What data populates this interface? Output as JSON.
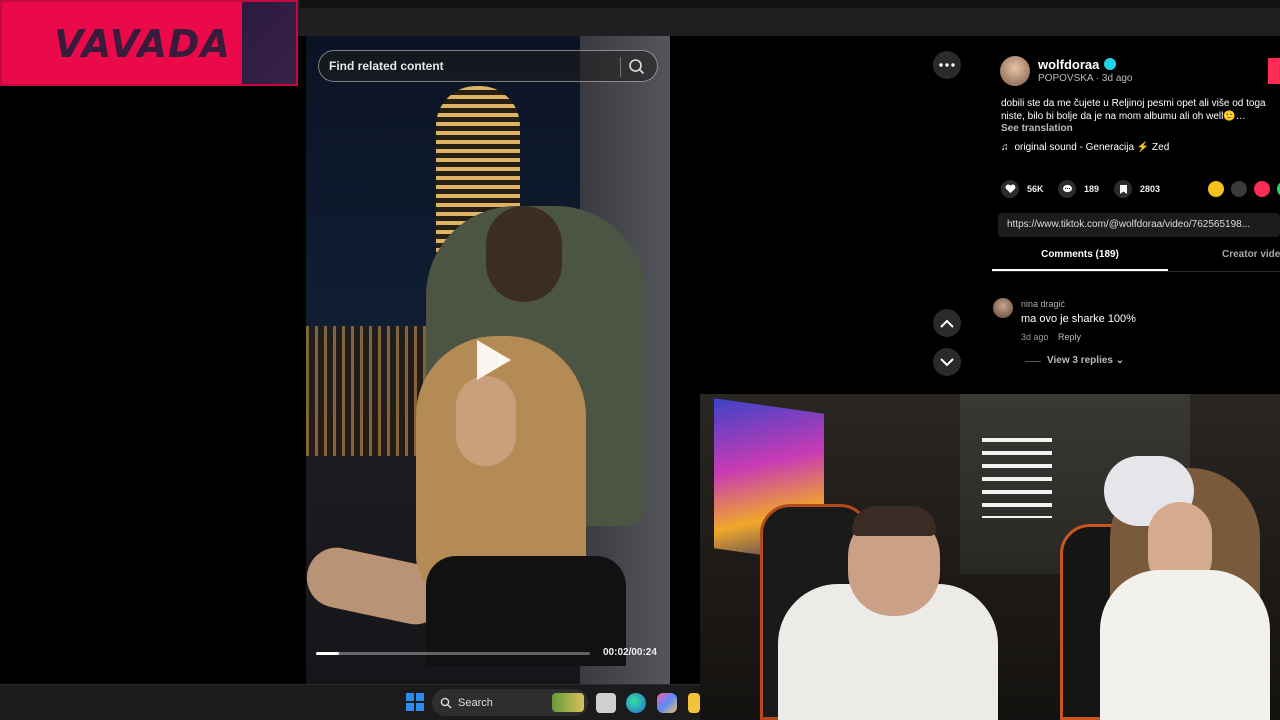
{
  "sponsor": {
    "logo_text": "VAVADA"
  },
  "video": {
    "search_placeholder": "Find related content",
    "time": "00:02/00:24",
    "progress": 0.083
  },
  "post": {
    "username": "wolfdoraa",
    "meta": "POPOVSKA · 3d ago",
    "caption": "dobili ste da me čujete u Reljinoj pesmi opet ali više od toga niste, bilo bi bolje da je na mom albumu ali oh well🙂…",
    "see_translation": "See translation",
    "sound": "original sound - Generacija ⚡ Zed",
    "likes": "56K",
    "comments": "189",
    "saves": "2803",
    "url": "https://www.tiktok.com/@wolfdoraa/video/762565198..."
  },
  "tabs": {
    "comments": "Comments (189)",
    "creator": "Creator vide"
  },
  "comment": {
    "author": "nina dragić",
    "text": "ma ovo je sharke 100%",
    "time": "3d ago",
    "reply": "Reply",
    "view_replies": "View 3 replies ⌄"
  },
  "taskbar": {
    "search_label": "Search"
  },
  "colors": {
    "accent": "#fe2c55",
    "sponsor": "#ea0a4a",
    "verified": "#20d5ec"
  },
  "icons": [
    "search-icon",
    "play-icon",
    "more-icon",
    "chevron-up-icon",
    "chevron-down-icon",
    "heart-icon",
    "comment-icon",
    "bookmark-icon",
    "music-note-icon",
    "windows-start-icon"
  ]
}
